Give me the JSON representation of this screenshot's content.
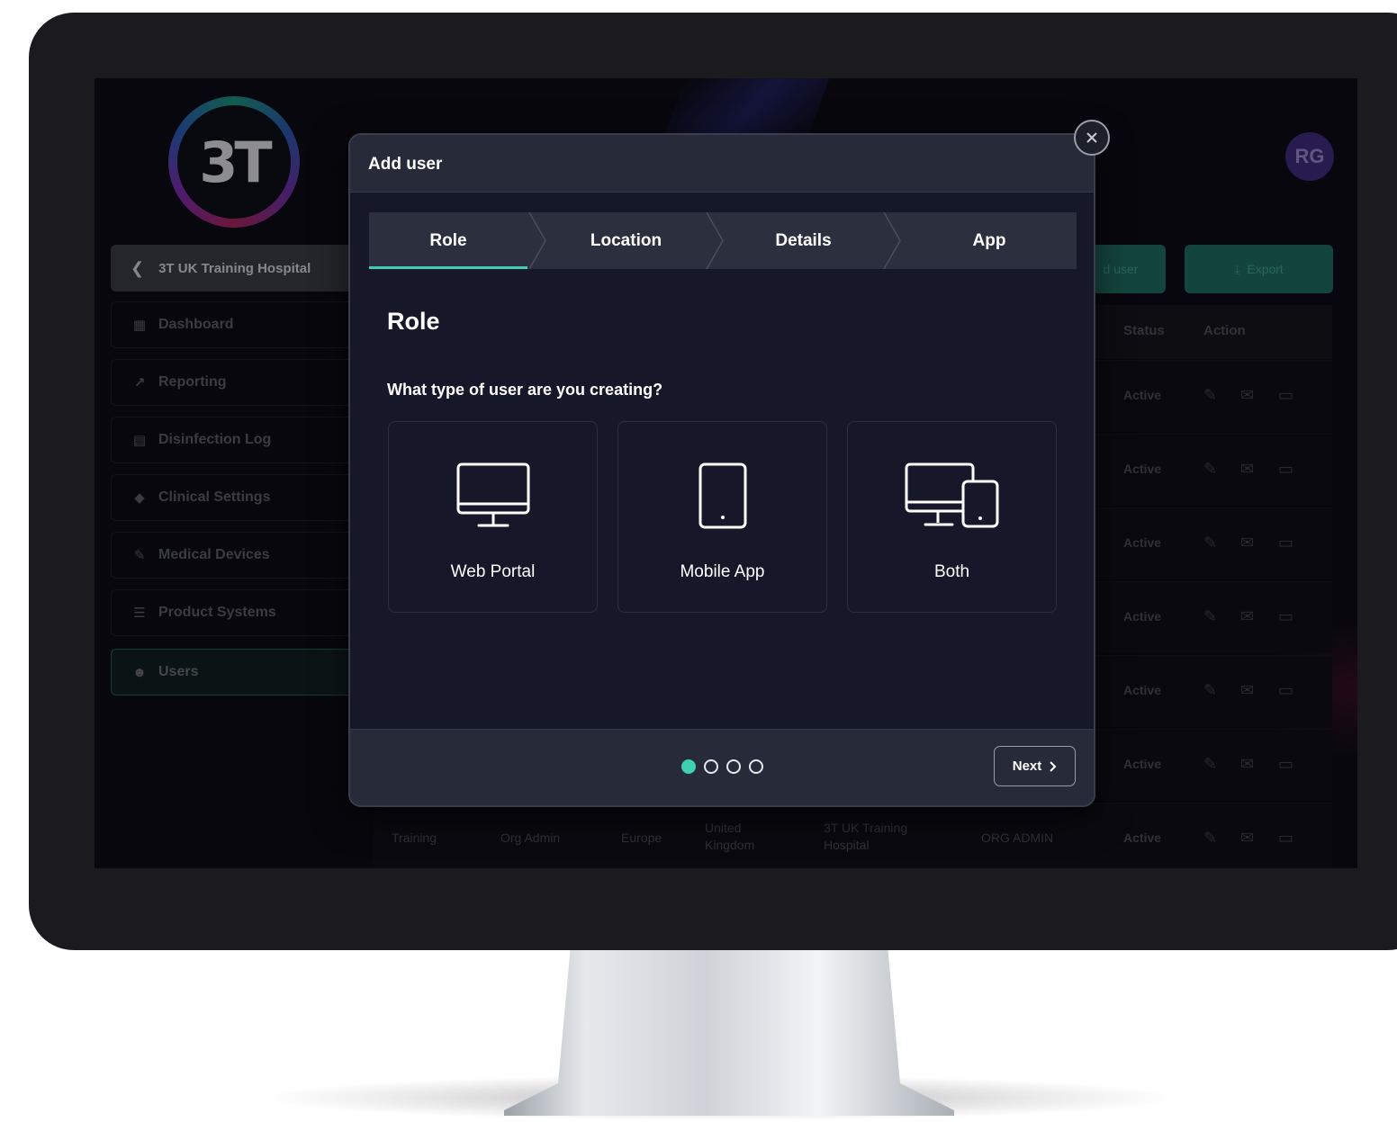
{
  "colors": {
    "accent": "#3fd0b1",
    "modal_bg": "#161728",
    "header_bg": "#272a38"
  },
  "app": {
    "logo_text": "3T",
    "back_label": "3T UK Training Hospital",
    "avatar_initials": "RG",
    "nav": [
      {
        "label": "Dashboard",
        "icon": "grid-icon"
      },
      {
        "label": "Reporting",
        "icon": "trend-icon"
      },
      {
        "label": "Disinfection Log",
        "icon": "document-icon"
      },
      {
        "label": "Clinical Settings",
        "icon": "diamond-icon"
      },
      {
        "label": "Medical Devices",
        "icon": "pen-icon"
      },
      {
        "label": "Product Systems",
        "icon": "list-icon"
      },
      {
        "label": "Users",
        "icon": "users-icon"
      }
    ],
    "add_user_label": "d user",
    "export_label": "Export",
    "table": {
      "headers": {
        "status": "Status",
        "action": "Action"
      },
      "status_values": [
        "Active",
        "Active",
        "Active",
        "Active",
        "Active",
        "Active",
        "Active"
      ],
      "last_row": [
        "Training",
        "Org Admin",
        "Europe",
        "United Kingdom",
        "3T UK Training Hospital",
        "ORG ADMIN"
      ]
    }
  },
  "modal": {
    "title": "Add user",
    "steps": [
      "Role",
      "Location",
      "Details",
      "App"
    ],
    "active_step": 0,
    "section_title": "Role",
    "question": "What type of user are you creating?",
    "options": [
      {
        "label": "Web Portal",
        "icon": "monitor-icon"
      },
      {
        "label": "Mobile App",
        "icon": "tablet-icon"
      },
      {
        "label": "Both",
        "icon": "monitor-tablet-icon"
      }
    ],
    "page_count": 4,
    "current_page": 1,
    "next_label": "Next"
  }
}
